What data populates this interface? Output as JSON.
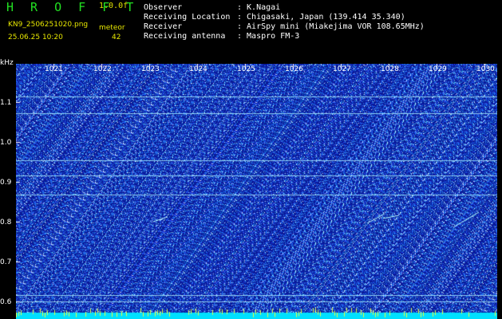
{
  "header": {
    "title": "H R O F F T",
    "version": "1.0.0f",
    "filename": "KN9_2506251020.png",
    "datetime": "25.06.25 10:20",
    "meteor_label": "meteor",
    "meteor_count": "42"
  },
  "info": [
    {
      "label": "Observer",
      "value": ": K.Nagai"
    },
    {
      "label": "Receiving Location",
      "value": ": Chigasaki, Japan (139.414 35.340)"
    },
    {
      "label": "Receiver",
      "value": ": AirSpy mini (Miakejima VOR 108.65MHz)"
    },
    {
      "label": "Receiving antenna",
      "value": ": Maspro FM-3"
    }
  ],
  "axis": {
    "y_unit": "kHz",
    "y_ticks": [
      "1.1",
      "1.0",
      "0.9",
      "0.8",
      "0.7",
      "0.6"
    ],
    "minute_ticks": [
      "1021",
      "1022",
      "1023",
      "1024",
      "1025",
      "1026",
      "1027",
      "1028",
      "1029",
      "1030"
    ]
  },
  "colors": {
    "background": "#0a1a9a",
    "noise": "#3a6cff",
    "line": "#aaf0ff",
    "title": "#22e022",
    "label_yellow": "#e6e600"
  }
}
